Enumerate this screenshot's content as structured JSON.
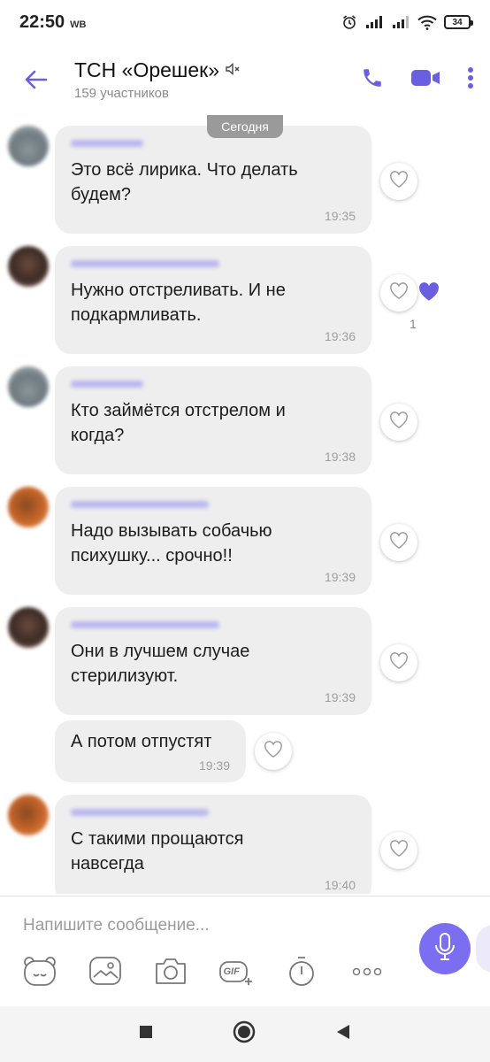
{
  "status_bar": {
    "time": "22:50",
    "carrier": "WB",
    "battery": "34"
  },
  "header": {
    "title": "ТСН «Орешек»",
    "subtitle": "159 участников"
  },
  "date_label": "Сегодня",
  "messages": [
    {
      "text_line1": "Это всё лирика. Что делать",
      "text_line2": "будем?",
      "time": "19:35"
    },
    {
      "text_line1": "Нужно отстреливать. И не",
      "text_line2": "подкармливать.",
      "time": "19:36",
      "like_count": "1"
    },
    {
      "text_line1": "Кто займётся отстрелом и",
      "text_line2": "когда?",
      "time": "19:38"
    },
    {
      "text_line1": "Надо вызывать собачью",
      "text_line2": "психушку... срочно!!",
      "time": "19:39"
    },
    {
      "text_line1": "Они в лучшем случае",
      "text_line2": "стерилизуют.",
      "time": "19:39"
    },
    {
      "text_line1": "А потом отпустят",
      "time": "19:39"
    },
    {
      "text_line1": "С такими прощаются",
      "text_line2": "навсегда",
      "time": "19:40"
    }
  ],
  "composer": {
    "placeholder": "Напишите сообщение...",
    "gif_label": "GIF"
  },
  "colors": {
    "accent": "#7b6ef0",
    "bubble": "#eeeeee",
    "header_icons": "#6a5fe0"
  }
}
